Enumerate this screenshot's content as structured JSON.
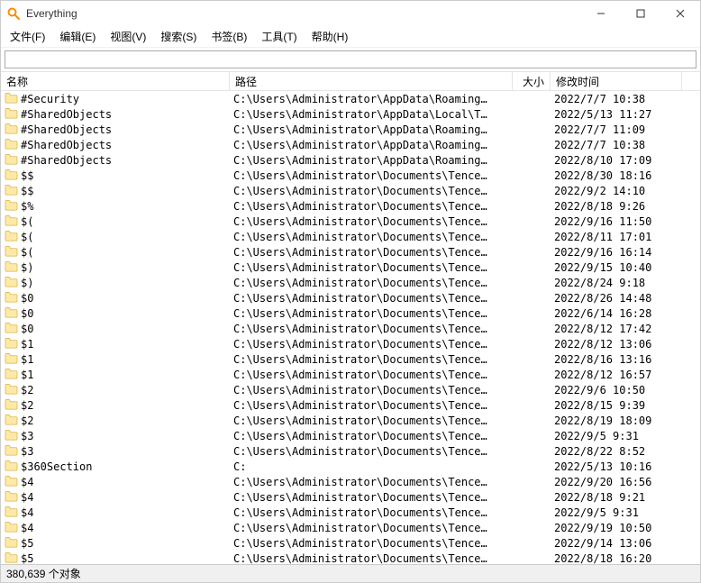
{
  "window": {
    "title": "Everything"
  },
  "menus": [
    {
      "label": "文件(F)"
    },
    {
      "label": "编辑(E)"
    },
    {
      "label": "视图(V)"
    },
    {
      "label": "搜索(S)"
    },
    {
      "label": "书签(B)"
    },
    {
      "label": "工具(T)"
    },
    {
      "label": "帮助(H)"
    }
  ],
  "search": {
    "value": "",
    "placeholder": ""
  },
  "columns": {
    "name": "名称",
    "path": "路径",
    "size": "大小",
    "date": "修改时间"
  },
  "rows": [
    {
      "name": "#Security",
      "path": "C:\\Users\\Administrator\\AppData\\Roaming…",
      "size": "",
      "date": "2022/7/7 10:38"
    },
    {
      "name": "#SharedObjects",
      "path": "C:\\Users\\Administrator\\AppData\\Local\\T…",
      "size": "",
      "date": "2022/5/13 11:27"
    },
    {
      "name": "#SharedObjects",
      "path": "C:\\Users\\Administrator\\AppData\\Roaming…",
      "size": "",
      "date": "2022/7/7 11:09"
    },
    {
      "name": "#SharedObjects",
      "path": "C:\\Users\\Administrator\\AppData\\Roaming…",
      "size": "",
      "date": "2022/7/7 10:38"
    },
    {
      "name": "#SharedObjects",
      "path": "C:\\Users\\Administrator\\AppData\\Roaming…",
      "size": "",
      "date": "2022/8/10 17:09"
    },
    {
      "name": "$$",
      "path": "C:\\Users\\Administrator\\Documents\\Tence…",
      "size": "",
      "date": "2022/8/30 18:16"
    },
    {
      "name": "$$",
      "path": "C:\\Users\\Administrator\\Documents\\Tence…",
      "size": "",
      "date": "2022/9/2 14:10"
    },
    {
      "name": "$%",
      "path": "C:\\Users\\Administrator\\Documents\\Tence…",
      "size": "",
      "date": "2022/8/18 9:26"
    },
    {
      "name": "$(",
      "path": "C:\\Users\\Administrator\\Documents\\Tence…",
      "size": "",
      "date": "2022/9/16 11:50"
    },
    {
      "name": "$(",
      "path": "C:\\Users\\Administrator\\Documents\\Tence…",
      "size": "",
      "date": "2022/8/11 17:01"
    },
    {
      "name": "$(",
      "path": "C:\\Users\\Administrator\\Documents\\Tence…",
      "size": "",
      "date": "2022/9/16 16:14"
    },
    {
      "name": "$)",
      "path": "C:\\Users\\Administrator\\Documents\\Tence…",
      "size": "",
      "date": "2022/9/15 10:40"
    },
    {
      "name": "$)",
      "path": "C:\\Users\\Administrator\\Documents\\Tence…",
      "size": "",
      "date": "2022/8/24 9:18"
    },
    {
      "name": "$0",
      "path": "C:\\Users\\Administrator\\Documents\\Tence…",
      "size": "",
      "date": "2022/8/26 14:48"
    },
    {
      "name": "$0",
      "path": "C:\\Users\\Administrator\\Documents\\Tence…",
      "size": "",
      "date": "2022/6/14 16:28"
    },
    {
      "name": "$0",
      "path": "C:\\Users\\Administrator\\Documents\\Tence…",
      "size": "",
      "date": "2022/8/12 17:42"
    },
    {
      "name": "$1",
      "path": "C:\\Users\\Administrator\\Documents\\Tence…",
      "size": "",
      "date": "2022/8/12 13:06"
    },
    {
      "name": "$1",
      "path": "C:\\Users\\Administrator\\Documents\\Tence…",
      "size": "",
      "date": "2022/8/16 13:16"
    },
    {
      "name": "$1",
      "path": "C:\\Users\\Administrator\\Documents\\Tence…",
      "size": "",
      "date": "2022/8/12 16:57"
    },
    {
      "name": "$2",
      "path": "C:\\Users\\Administrator\\Documents\\Tence…",
      "size": "",
      "date": "2022/9/6 10:50"
    },
    {
      "name": "$2",
      "path": "C:\\Users\\Administrator\\Documents\\Tence…",
      "size": "",
      "date": "2022/8/15 9:39"
    },
    {
      "name": "$2",
      "path": "C:\\Users\\Administrator\\Documents\\Tence…",
      "size": "",
      "date": "2022/8/19 18:09"
    },
    {
      "name": "$3",
      "path": "C:\\Users\\Administrator\\Documents\\Tence…",
      "size": "",
      "date": "2022/9/5 9:31"
    },
    {
      "name": "$3",
      "path": "C:\\Users\\Administrator\\Documents\\Tence…",
      "size": "",
      "date": "2022/8/22 8:52"
    },
    {
      "name": "$360Section",
      "path": "C:",
      "size": "",
      "date": "2022/5/13 10:16"
    },
    {
      "name": "$4",
      "path": "C:\\Users\\Administrator\\Documents\\Tence…",
      "size": "",
      "date": "2022/9/20 16:56"
    },
    {
      "name": "$4",
      "path": "C:\\Users\\Administrator\\Documents\\Tence…",
      "size": "",
      "date": "2022/8/18 9:21"
    },
    {
      "name": "$4",
      "path": "C:\\Users\\Administrator\\Documents\\Tence…",
      "size": "",
      "date": "2022/9/5 9:31"
    },
    {
      "name": "$4",
      "path": "C:\\Users\\Administrator\\Documents\\Tence…",
      "size": "",
      "date": "2022/9/19 10:50"
    },
    {
      "name": "$5",
      "path": "C:\\Users\\Administrator\\Documents\\Tence…",
      "size": "",
      "date": "2022/9/14 13:06"
    },
    {
      "name": "$5",
      "path": "C:\\Users\\Administrator\\Documents\\Tence…",
      "size": "",
      "date": "2022/8/18 16:20"
    }
  ],
  "status": {
    "text": "380,639 个对象"
  },
  "icons": {
    "app_color": "#ff8c00",
    "folder_fill": "#ffe9a6",
    "folder_stroke": "#d9b34a"
  }
}
